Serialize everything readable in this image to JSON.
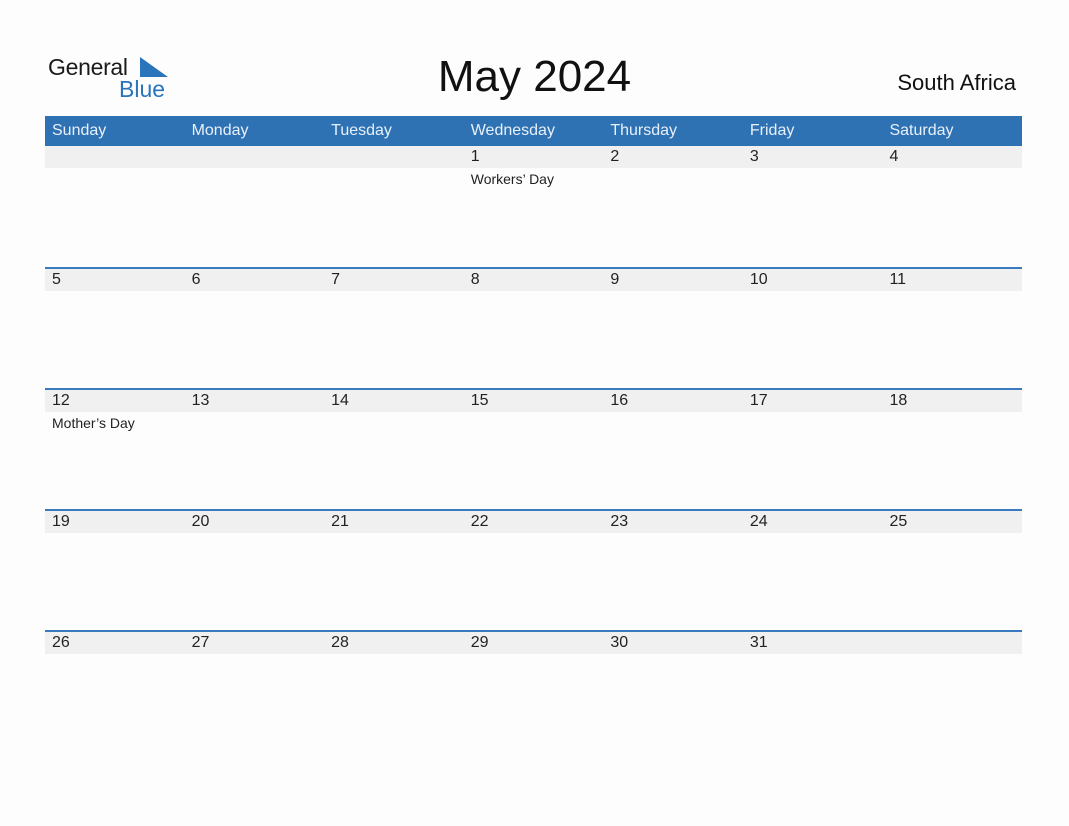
{
  "logo": {
    "general": "General",
    "blue": "Blue"
  },
  "title": "May 2024",
  "country": "South Africa",
  "weekdays": [
    "Sunday",
    "Monday",
    "Tuesday",
    "Wednesday",
    "Thursday",
    "Friday",
    "Saturday"
  ],
  "weeks": [
    {
      "days": [
        "",
        "",
        "",
        "1",
        "2",
        "3",
        "4"
      ],
      "events": [
        "",
        "",
        "",
        "Workers’ Day",
        "",
        "",
        ""
      ]
    },
    {
      "days": [
        "5",
        "6",
        "7",
        "8",
        "9",
        "10",
        "11"
      ],
      "events": [
        "",
        "",
        "",
        "",
        "",
        "",
        ""
      ]
    },
    {
      "days": [
        "12",
        "13",
        "14",
        "15",
        "16",
        "17",
        "18"
      ],
      "events": [
        "Mother’s Day",
        "",
        "",
        "",
        "",
        "",
        ""
      ]
    },
    {
      "days": [
        "19",
        "20",
        "21",
        "22",
        "23",
        "24",
        "25"
      ],
      "events": [
        "",
        "",
        "",
        "",
        "",
        "",
        ""
      ]
    },
    {
      "days": [
        "26",
        "27",
        "28",
        "29",
        "30",
        "31",
        ""
      ],
      "events": [
        "",
        "",
        "",
        "",
        "",
        "",
        ""
      ]
    }
  ]
}
